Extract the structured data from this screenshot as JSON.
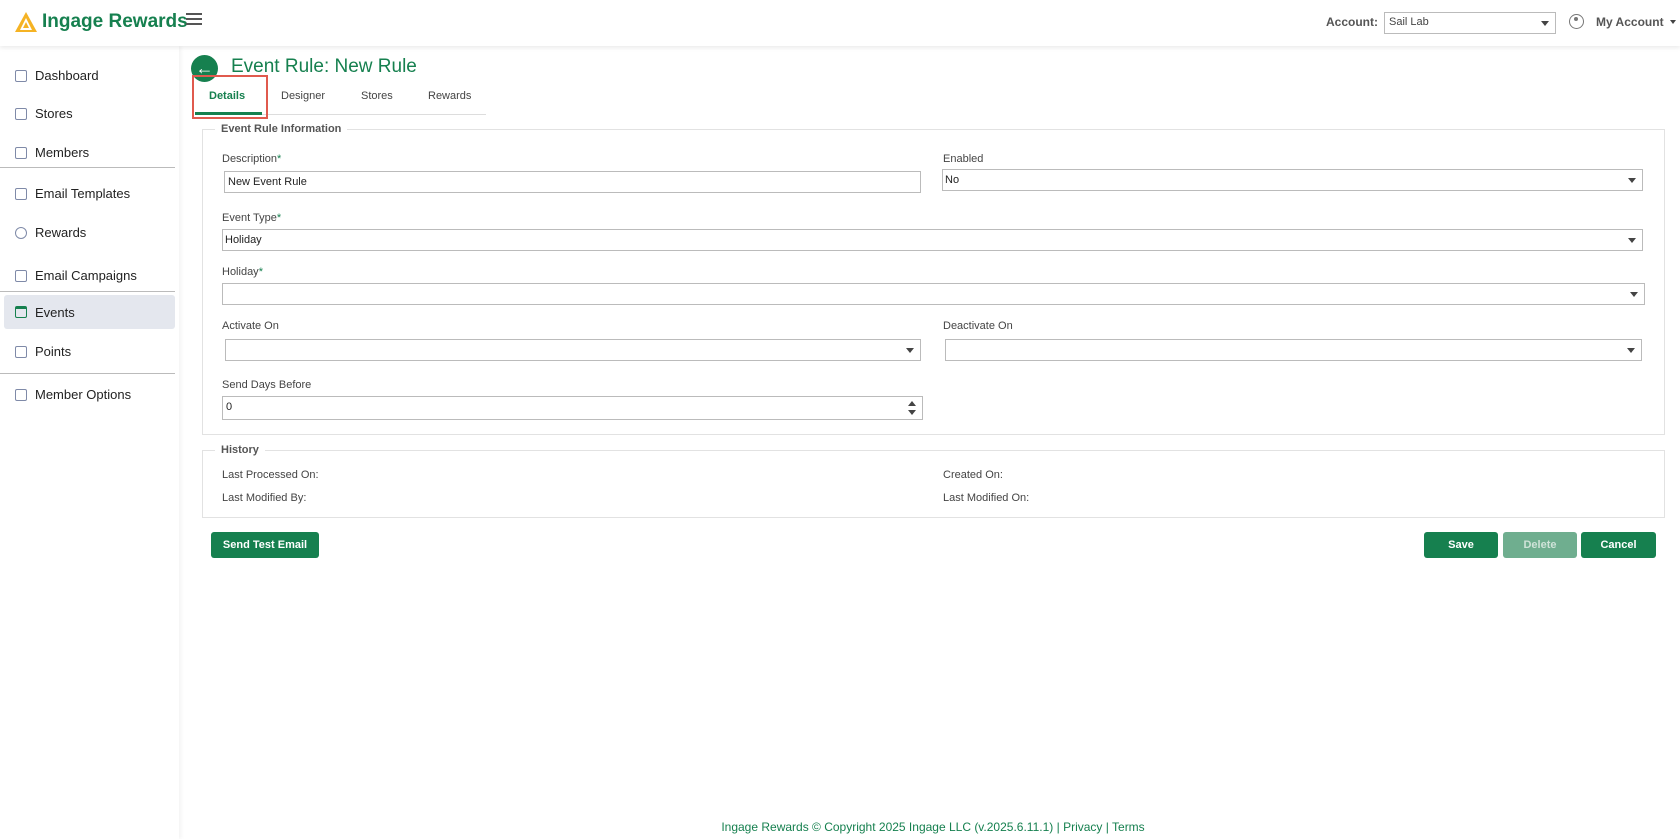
{
  "app": {
    "brand": "Ingage Rewards"
  },
  "header": {
    "account_label": "Account:",
    "account_value": "Sail Lab",
    "my_account": "My Account"
  },
  "sidebar": {
    "items": [
      {
        "label": "Dashboard",
        "icon": "dashboard-icon"
      },
      {
        "label": "Stores",
        "icon": "store-icon"
      },
      {
        "label": "Members",
        "icon": "members-icon"
      },
      {
        "label": "Email Templates",
        "icon": "email-template-icon"
      },
      {
        "label": "Rewards",
        "icon": "award-icon"
      },
      {
        "label": "Email Campaigns",
        "icon": "envelope-icon"
      },
      {
        "label": "Events",
        "icon": "calendar-icon",
        "active": true
      },
      {
        "label": "Points",
        "icon": "list-icon"
      },
      {
        "label": "Member Options",
        "icon": "cube-icon"
      }
    ]
  },
  "page": {
    "title": "Event Rule: New Rule"
  },
  "tabs": [
    {
      "label": "Details",
      "active": true
    },
    {
      "label": "Designer"
    },
    {
      "label": "Stores"
    },
    {
      "label": "Rewards"
    }
  ],
  "info": {
    "legend": "Event Rule Information",
    "description_label": "Description",
    "description_value": "New Event Rule",
    "enabled_label": "Enabled",
    "enabled_value": "No",
    "event_type_label": "Event Type",
    "event_type_value": "Holiday",
    "holiday_label": "Holiday",
    "holiday_value": "",
    "activate_label": "Activate On",
    "activate_value": "",
    "deactivate_label": "Deactivate On",
    "deactivate_value": "",
    "send_days_label": "Send Days Before",
    "send_days_value": "0",
    "required_mark": "*"
  },
  "history": {
    "legend": "History",
    "last_processed": "Last Processed On:",
    "created_on": "Created On:",
    "last_modified_by": "Last Modified By:",
    "last_modified_on": "Last Modified On:"
  },
  "actions": {
    "send_test": "Send Test Email",
    "save": "Save",
    "delete": "Delete",
    "cancel": "Cancel"
  },
  "footer": {
    "copyright": "Ingage Rewards © Copyright 2025 Ingage LLC (v.2025.6.11.1)",
    "sep": "|",
    "privacy": "Privacy",
    "terms": "Terms"
  },
  "colors": {
    "brand_green": "#16804f",
    "highlight": "#e05a4e",
    "logo": "#f5b324"
  }
}
